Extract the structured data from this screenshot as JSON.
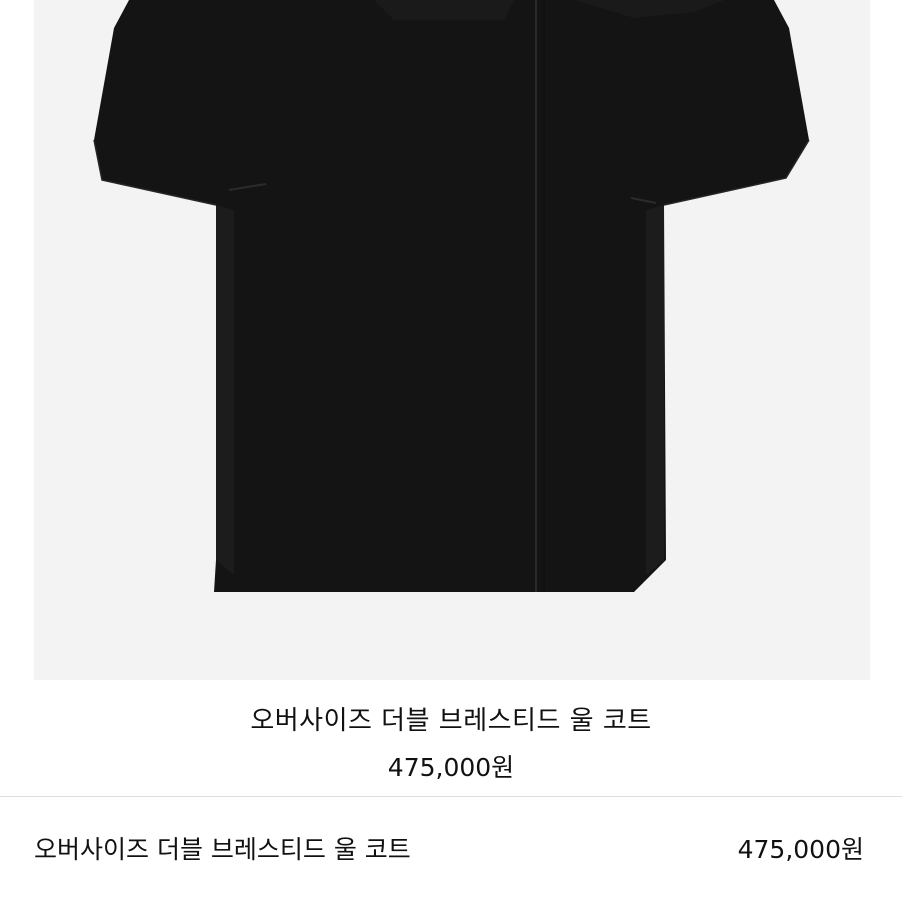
{
  "product": {
    "image_alt": "black oversized double-breasted wool coat",
    "hero_title": "오버사이즈 더블 브레스티드 울 코트",
    "hero_price": "475,000원"
  },
  "selected_item": {
    "name": "오버사이즈 더블 브레스티드 울 코트",
    "price": "475,000원"
  },
  "colors": {
    "coat": "#141414",
    "background": "#f3f3f3",
    "divider": "#dedede"
  }
}
